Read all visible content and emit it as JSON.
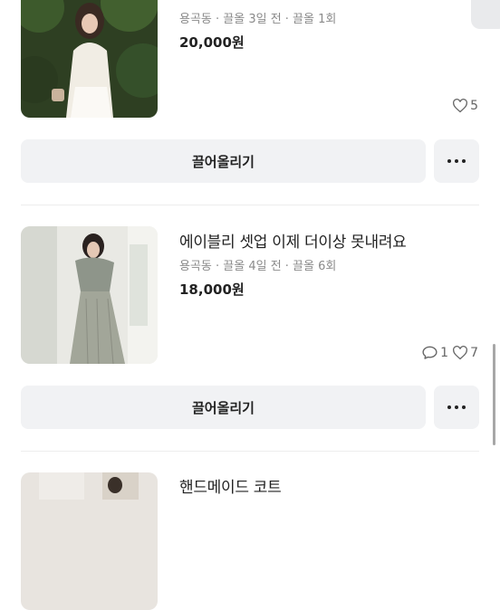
{
  "listings": [
    {
      "title": "",
      "meta": "용곡동 · 끌올 3일 전 · 끌올 1회",
      "price": "20,000원",
      "likes": "5",
      "bump_label": "끌어올리기",
      "more_icon": "more-horizontal-icon"
    },
    {
      "title": "에이블리 셋업 이제 더이상 못내려요",
      "meta": "용곡동 · 끌올 4일 전 · 끌올 6회",
      "price": "18,000원",
      "chats": "1",
      "likes": "7",
      "bump_label": "끌어올리기",
      "more_icon": "more-horizontal-icon"
    },
    {
      "title": "핸드메이드 코트"
    }
  ],
  "colors": {
    "button_bg": "#f1f2f4",
    "meta_text": "#8a8a8a",
    "divider": "#ededed"
  }
}
